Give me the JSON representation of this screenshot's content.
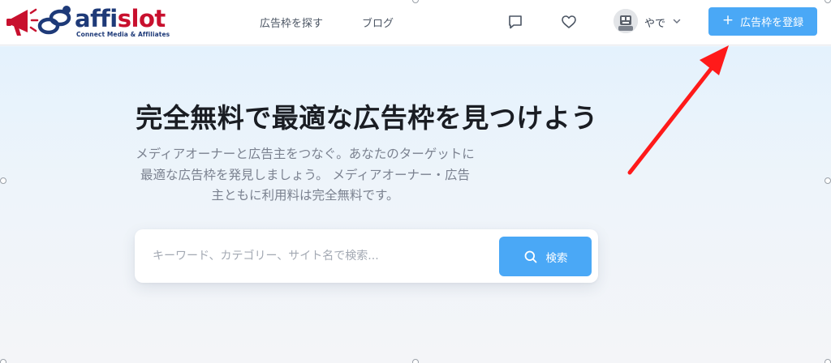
{
  "header": {
    "logo": {
      "word_main": "affi",
      "word_accent": "slot",
      "tagline": "Connect Media & Affiliates"
    },
    "nav": [
      {
        "label": "広告枠を探す"
      },
      {
        "label": "ブログ"
      }
    ],
    "icons": {
      "messages": "chat-bubble-icon",
      "favorites": "heart-icon"
    },
    "user": {
      "name": "やで",
      "avatar": "user-avatar",
      "chevron": "chevron-down-icon"
    },
    "register_button": {
      "icon": "+",
      "label": "広告枠を登録"
    }
  },
  "hero": {
    "title": "完全無料で最適な広告枠を見つけよう",
    "description": "メディアオーナーと広告主をつなぐ。あなたのターゲットに最適な広告枠を発見しましょう。 メディアオーナー・広告主ともに利用料は完全無料です。",
    "search": {
      "placeholder": "キーワード、カテゴリー、サイト名で検索...",
      "value": "",
      "button_label": "検索",
      "button_icon": "search-icon"
    }
  },
  "colors": {
    "accent": "#4aa8f6",
    "brand_navy": "#1e3a78",
    "brand_red": "#c8102e",
    "annotation_arrow": "#ff1a1a"
  }
}
